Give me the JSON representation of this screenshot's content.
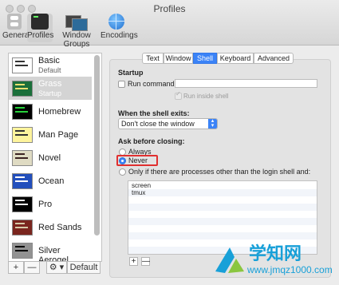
{
  "window": {
    "title": "Profiles"
  },
  "toolbar": {
    "items": [
      {
        "label": "General"
      },
      {
        "label": "Profiles"
      },
      {
        "label": "Window Groups"
      },
      {
        "label": "Encodings"
      }
    ]
  },
  "profiles": [
    {
      "name": "Basic",
      "sub": "Default",
      "thumb_bg": "#ffffff",
      "thumb_fg": "#333333"
    },
    {
      "name": "Grass",
      "sub": "Startup",
      "thumb_bg": "#1b6f3a",
      "thumb_fg": "#e8e070"
    },
    {
      "name": "Homebrew",
      "sub": "",
      "thumb_bg": "#000000",
      "thumb_fg": "#27d13b"
    },
    {
      "name": "Man Page",
      "sub": "",
      "thumb_bg": "#fef49c",
      "thumb_fg": "#333333"
    },
    {
      "name": "Novel",
      "sub": "",
      "thumb_bg": "#dfdbc3",
      "thumb_fg": "#3b2322"
    },
    {
      "name": "Ocean",
      "sub": "",
      "thumb_bg": "#224fbc",
      "thumb_fg": "#ffffff"
    },
    {
      "name": "Pro",
      "sub": "",
      "thumb_bg": "#000000",
      "thumb_fg": "#f2f2f2"
    },
    {
      "name": "Red Sands",
      "sub": "",
      "thumb_bg": "#7a251e",
      "thumb_fg": "#d7c9a7"
    },
    {
      "name": "Silver Aerogel",
      "sub": "",
      "thumb_bg": "#929292",
      "thumb_fg": "#000000"
    }
  ],
  "sidebar_footer": {
    "add": "+",
    "remove": "—",
    "gear": "⚙ ▾",
    "default": "Default"
  },
  "tabs": [
    {
      "label": "Text"
    },
    {
      "label": "Window"
    },
    {
      "label": "Shell"
    },
    {
      "label": "Keyboard"
    },
    {
      "label": "Advanced"
    }
  ],
  "shell": {
    "startup_heading": "Startup",
    "run_command_label": "Run command:",
    "run_command_value": "",
    "run_inside_shell_label": "Run inside shell",
    "exit_heading": "When the shell exits:",
    "exit_option": "Don't close the window",
    "ask_heading": "Ask before closing:",
    "opt_always": "Always",
    "opt_never": "Never",
    "opt_only": "Only if there are processes other than the login shell and:",
    "processes": [
      "screen",
      "tmux"
    ],
    "list_add": "+",
    "list_remove": "—"
  },
  "watermark": {
    "text": "学知网",
    "url": "www.jmqz1000.com"
  },
  "colors": {
    "accent": "#3b83f7",
    "highlight": "#e03030",
    "watermark": "#18a0d8"
  }
}
